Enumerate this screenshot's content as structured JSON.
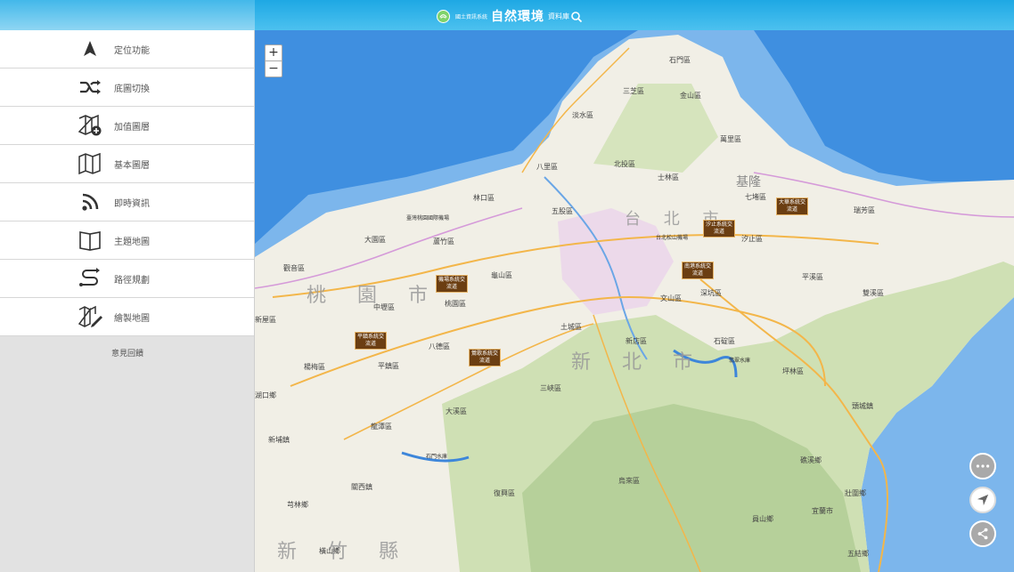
{
  "header": {
    "brand_small": "國土資訊系統",
    "brand_title": "自然環境",
    "brand_sub": "資料庫"
  },
  "sidebar": {
    "items": [
      {
        "label": "定位功能",
        "icon": "location-arrow-icon"
      },
      {
        "label": "底圖切換",
        "icon": "shuffle-icon"
      },
      {
        "label": "加值圖層",
        "icon": "map-add-icon"
      },
      {
        "label": "基本圖層",
        "icon": "map-icon"
      },
      {
        "label": "即時資訊",
        "icon": "rss-icon"
      },
      {
        "label": "主題地圖",
        "icon": "book-icon"
      },
      {
        "label": "路徑規劃",
        "icon": "route-icon"
      },
      {
        "label": "繪製地圖",
        "icon": "map-draw-icon"
      }
    ],
    "feedback": "意見回饋"
  },
  "map": {
    "zoom_in": "+",
    "zoom_out": "−",
    "districts": [
      "石門區",
      "三芝區",
      "金山區",
      "淡水區",
      "萬里區",
      "八里區",
      "北投區",
      "士林區",
      "林口區",
      "五股區",
      "七堵區",
      "瑞芳區",
      "大園區",
      "蘆竹區",
      "汐止區",
      "平溪區",
      "蘆竹區",
      "龜山區",
      "雙溪區",
      "中壢區",
      "桃園區",
      "文山區",
      "深坑區",
      "觀音區",
      "八德區",
      "土城區",
      "新店區",
      "石碇區",
      "楊梅區",
      "平鎮區",
      "坪林區",
      "湖口鄉",
      "三峽區",
      "頭城鎮",
      "大溪區",
      "新埔鎮",
      "龍潭區",
      "烏來區",
      "礁溪鄉",
      "關西鎮",
      "宜蘭市",
      "芎林鄉",
      "復興區",
      "員山鄉",
      "橫山鄉",
      "五結鄉",
      "壯圍鄉",
      "新屋區",
      "基隆"
    ],
    "city_labels": [
      "桃 園 市",
      "新 北 市",
      "台 北 市",
      "新 竹 縣"
    ],
    "airports": [
      "臺灣桃園國際機場",
      "台北松山機場"
    ],
    "interchanges": [
      "汐止系統交流道",
      "大華系統交流道",
      "南港系統交流道",
      "機場系統交流道",
      "平鎮系統交流道",
      "鶯歌系統交流道"
    ],
    "reservoirs": [
      "翡翠水庫",
      "石門水庫"
    ]
  },
  "colors": {
    "header": "#2aaee6",
    "sea": "#3f8fe0",
    "land": "#f3f0e8",
    "fab_gray": "#a9a9a9"
  }
}
